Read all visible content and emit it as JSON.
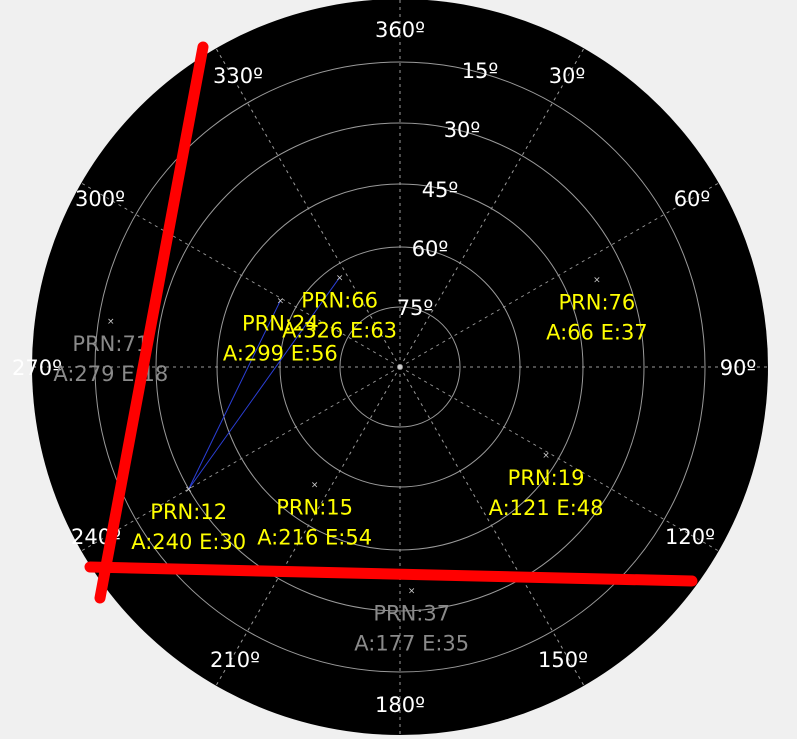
{
  "colors": {
    "background": "#f0f0f0",
    "dial": "#000000",
    "grid": "#9a9a9a",
    "label_text": "#ffffff",
    "active_sat": "#ffff00",
    "inactive_sat": "#8a8a8a",
    "link_line": "#2b3fd6",
    "marker": "#ff0000"
  },
  "azimuth_labels": [
    "360º",
    "30º",
    "60º",
    "90º",
    "120º",
    "150º",
    "180º",
    "210º",
    "240º",
    "270º",
    "300º",
    "330º"
  ],
  "elevation_labels": [
    "15º",
    "30º",
    "45º",
    "60º",
    "75º"
  ],
  "satellites": [
    {
      "prn": "PRN:66",
      "info": "A:326 E:63",
      "az": 326,
      "el": 63,
      "active": true
    },
    {
      "prn": "PRN:24",
      "info": "A:299 E:56",
      "az": 299,
      "el": 56,
      "active": true
    },
    {
      "prn": "PRN:76",
      "info": "A:66 E:37",
      "az": 66,
      "el": 37,
      "active": true
    },
    {
      "prn": "PRN:19",
      "info": "A:121 E:48",
      "az": 121,
      "el": 48,
      "active": true
    },
    {
      "prn": "PRN:15",
      "info": "A:216 E:54",
      "az": 216,
      "el": 54,
      "active": true
    },
    {
      "prn": "PRN:12",
      "info": "A:240 E:30",
      "az": 240,
      "el": 30,
      "active": true
    },
    {
      "prn": "PRN:71",
      "info": "A:279 E:18",
      "az": 279,
      "el": 18,
      "active": false
    },
    {
      "prn": "PRN:37",
      "info": "A:177 E:35",
      "az": 177,
      "el": 35,
      "active": false
    }
  ],
  "links": [
    [
      "PRN:66",
      "PRN:12"
    ],
    [
      "PRN:24",
      "PRN:12"
    ]
  ]
}
